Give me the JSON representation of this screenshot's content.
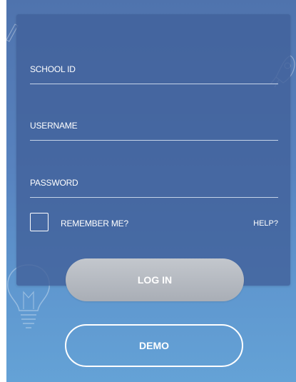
{
  "form": {
    "school_id_label": "SCHOOL ID",
    "username_label": "USERNAME",
    "password_label": "PASSWORD",
    "remember_label": "REMEMBER ME?",
    "help_label": "HELP?",
    "remember_checked": false
  },
  "buttons": {
    "login_label": "LOG IN",
    "demo_label": "DEMO"
  },
  "icons": {
    "background_doodles": [
      "lightbulb-icon",
      "rocket-icon",
      "pencil-icon"
    ]
  },
  "colors": {
    "background_top": "#4f73ad",
    "background_bottom": "#64a2d6",
    "card": "#42629b",
    "login_button": "#b5bac1",
    "text": "#ffffff"
  }
}
